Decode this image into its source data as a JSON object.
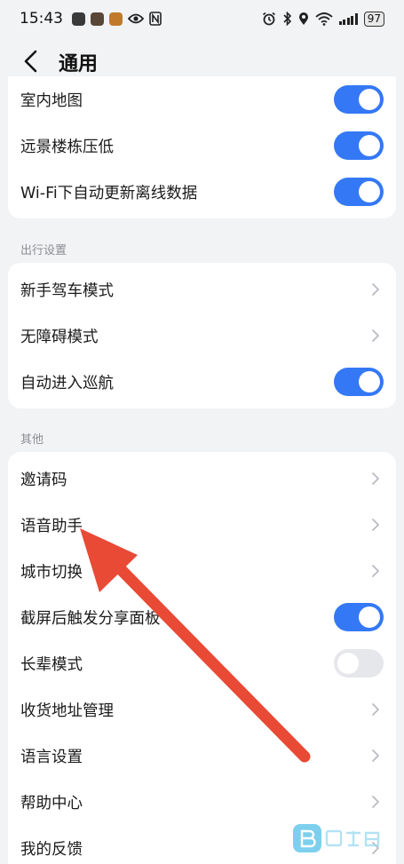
{
  "status_bar": {
    "time": "15:43",
    "battery": "97"
  },
  "header": {
    "title": "通用"
  },
  "card_map": {
    "items": [
      {
        "label": "室内地图",
        "control": "toggle",
        "on": true
      },
      {
        "label": "远景楼栋压低",
        "control": "toggle",
        "on": true
      },
      {
        "label": "Wi-Fi下自动更新离线数据",
        "control": "toggle",
        "on": true
      }
    ]
  },
  "section_travel": {
    "title": "出行设置",
    "items": [
      {
        "label": "新手驾车模式",
        "control": "chevron"
      },
      {
        "label": "无障碍模式",
        "control": "chevron"
      },
      {
        "label": "自动进入巡航",
        "control": "toggle",
        "on": true
      }
    ]
  },
  "section_other": {
    "title": "其他",
    "items": [
      {
        "label": "邀请码",
        "control": "chevron"
      },
      {
        "label": "语音助手",
        "control": "chevron"
      },
      {
        "label": "城市切换",
        "control": "chevron"
      },
      {
        "label": "截屏后触发分享面板",
        "control": "toggle",
        "on": true
      },
      {
        "label": "长辈模式",
        "control": "toggle",
        "on": false
      },
      {
        "label": "收货地址管理",
        "control": "chevron"
      },
      {
        "label": "语言设置",
        "control": "chevron"
      },
      {
        "label": "帮助中心",
        "control": "chevron"
      },
      {
        "label": "我的反馈",
        "control": "chevron"
      }
    ]
  },
  "annotation": {
    "arrow_color": "#e84a35",
    "accent_color": "#3478f6"
  }
}
